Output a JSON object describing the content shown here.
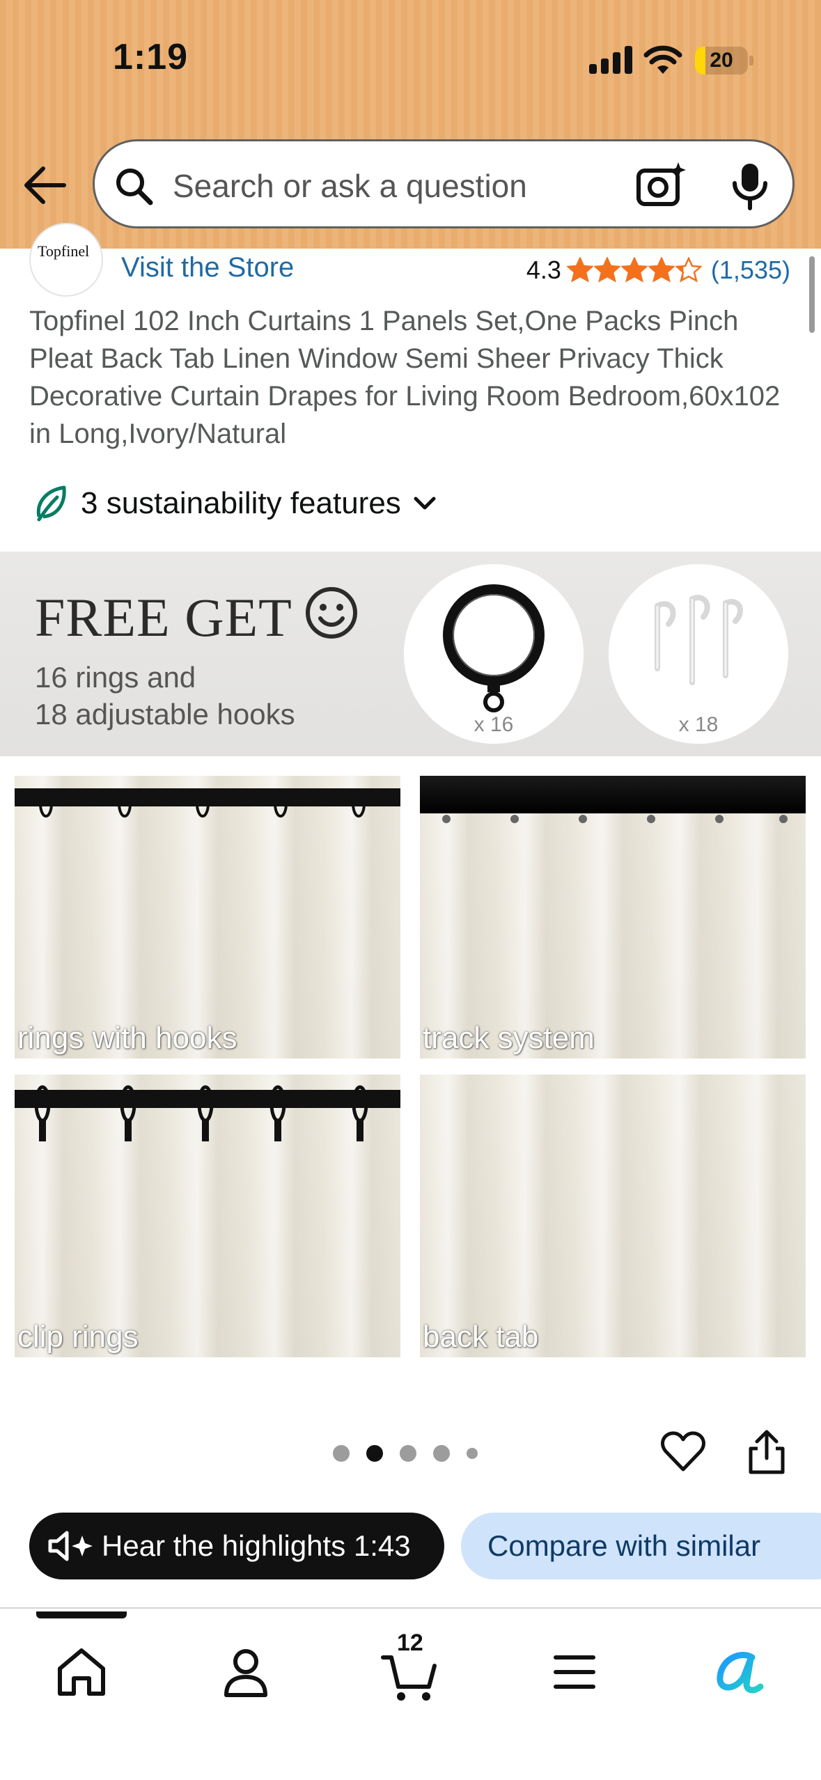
{
  "status_bar": {
    "time": "1:19",
    "battery_level": "20",
    "battery_fraction": 0.2
  },
  "header": {
    "search_placeholder": "Search or ask a question",
    "icons": [
      "back-arrow-icon",
      "search-icon",
      "camera-icon",
      "mic-icon"
    ]
  },
  "store": {
    "logo_text": "Topfinel",
    "visit_label": "Visit the Store",
    "rating": "4.3",
    "rating_value": 4.3,
    "rating_count": "(1,535)"
  },
  "product": {
    "title": "Topfinel 102 Inch Curtains 1 Panels Set,One Packs Pinch Pleat Back Tab Linen Window Semi Sheer Privacy Thick Decorative Curtain Drapes for Living Room Bedroom,60x102 in Long,Ivory/Natural",
    "sustainability_label": "3 sustainability features"
  },
  "banner": {
    "title": "FREE GET",
    "subtitle_line1": "16 rings and",
    "subtitle_line2": "18 adjustable hooks",
    "ring_qty": "x 16",
    "hook_qty": "x 18"
  },
  "photos": [
    {
      "label": "rings with hooks"
    },
    {
      "label": "track system"
    },
    {
      "label": "clip rings"
    },
    {
      "label": "back tab"
    }
  ],
  "carousel": {
    "total_dots": 5,
    "active_index": 1
  },
  "actions": {
    "hear_label": "Hear the highlights 1:43",
    "compare_label": "Compare with similar"
  },
  "bottom_nav": {
    "items": [
      "home-icon",
      "account-icon",
      "cart-icon",
      "menu-icon",
      "rufus-icon"
    ],
    "cart_count": "12"
  },
  "colors": {
    "header_bg": "#e8ac6e",
    "link_blue": "#1f6aa5",
    "star_orange": "#f3711d",
    "compare_bg": "#cfe3fb",
    "leaf_green": "#067d62"
  }
}
